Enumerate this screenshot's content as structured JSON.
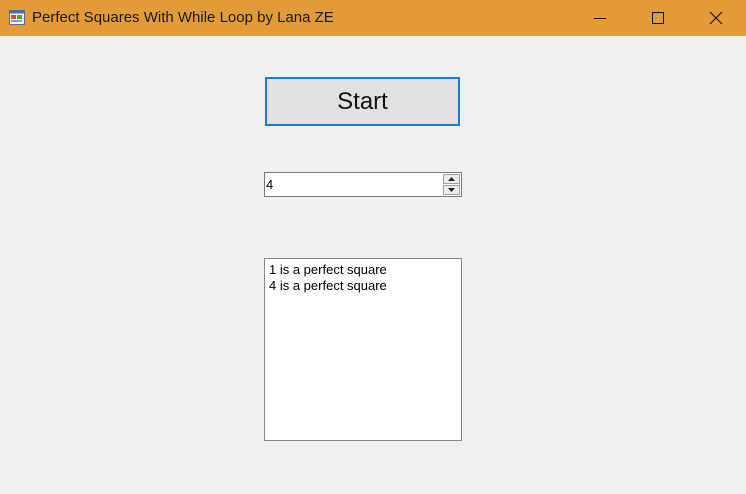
{
  "window": {
    "title": "Perfect Squares With While Loop by Lana ZE",
    "app_icon": "windows-form-icon",
    "title_bar_color": "#e39b39",
    "controls": [
      "minimize-icon",
      "maximize-icon",
      "close-icon"
    ]
  },
  "form": {
    "start_button_label": "Start",
    "number_input_value": "4",
    "results": [
      "1 is a perfect square",
      "4 is a perfect square"
    ]
  }
}
